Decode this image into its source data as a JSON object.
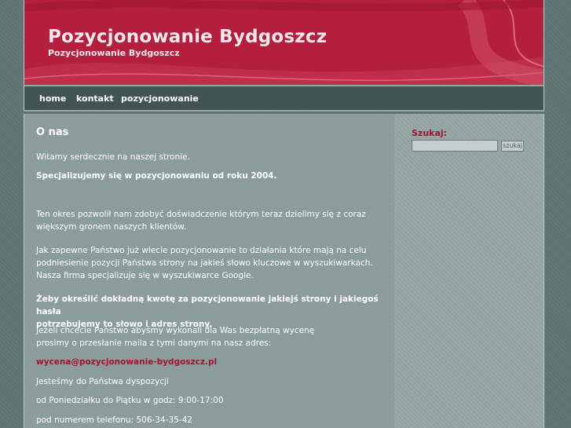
{
  "header": {
    "title": "Pozycjonowanie Bydgoszcz",
    "subtitle": "Pozycjonowanie Bydgoszcz"
  },
  "nav": {
    "items": [
      {
        "label": "home"
      },
      {
        "label": "kontakt"
      },
      {
        "label": "pozycjonowanie"
      }
    ]
  },
  "main": {
    "heading": "O nas",
    "p1": "Witamy serdecznie na naszej stronie.",
    "p2": "Specjalizujemy się w pozycjonowaniu od roku 2004.",
    "p3_l1": "Ten okres pozwolił nam zdobyć doświadczenie którym teraz dzielimy się z coraz",
    "p3_l2": "większym gronem naszych klientów.",
    "p4_l1": "Jak zapewne Państwo już wiecie pozycjonowanie to działania które mają na celu",
    "p4_l2": "podniesienie pozycji Państwa strony na jakieś słowo kluczowe w wyszukiwarkach.",
    "p4_l3": "Nasza firma specjalizuje się w wyszukiwarce Google.",
    "p5_l1": "Żeby określić dokładną kwotę za pozycjonowanie jakiejś strony i jakiegoś hasła",
    "p5_l2": "potrzebujemy to słowo i adres strony.",
    "p6_l1": "Jeżeli chcecie Państwo abyśmy wykonali dla Was bezpłatną wycenę",
    "p6_l2": "prosimy o przesłanie maila z tymi danymi na nasz adres:",
    "email": "wycena@pozycjonowanie-bydgoszcz.pl",
    "p7": "Jesteśmy do Państwa dyspozycji",
    "p8": "od Poniedziałku do Piątku w godz: 9:00-17:00",
    "p9": "pod numerem telefonu: 506-34-35-42"
  },
  "sidebar": {
    "search_label": "Szukaj:",
    "search_value": "",
    "search_button": "szukaj"
  }
}
